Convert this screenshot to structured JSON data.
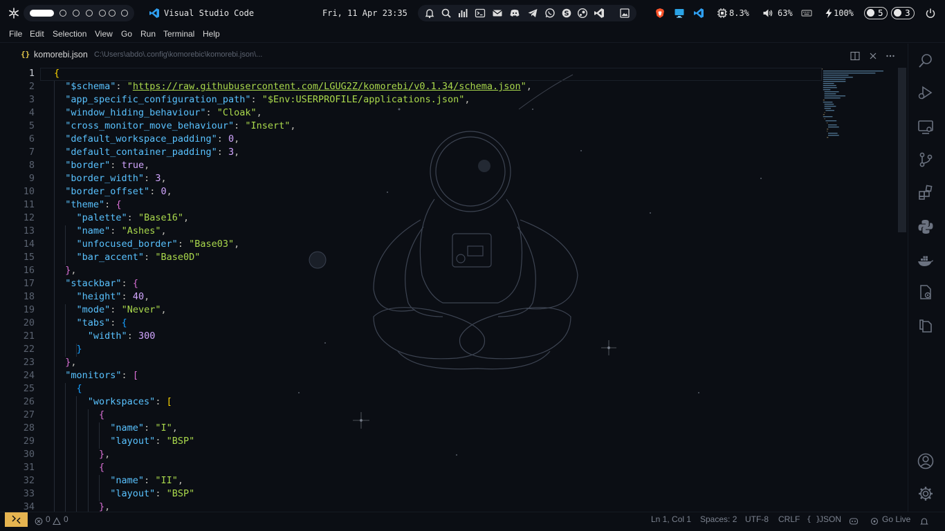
{
  "topbar": {
    "logo_icon": "snowflake-icon",
    "window_title": "Visual Studio Code",
    "datetime": "Fri, 11 Apr 23:35",
    "cpu": "8.3%",
    "volume": "63%",
    "battery": "100%",
    "badge_left": "5",
    "badge_right": "3"
  },
  "menu": [
    "File",
    "Edit",
    "Selection",
    "View",
    "Go",
    "Run",
    "Terminal",
    "Help"
  ],
  "tab": {
    "icon": "{}",
    "filename": "komorebi.json",
    "path": "C:\\Users\\abdo\\.config\\komorebic\\komorebi.json\\..."
  },
  "editor": {
    "line_numbers": [
      "1",
      "2",
      "3",
      "4",
      "5",
      "6",
      "7",
      "8",
      "9",
      "10",
      "11",
      "12",
      "13",
      "14",
      "15",
      "16",
      "17",
      "18",
      "19",
      "20",
      "21",
      "22",
      "23",
      "24",
      "25",
      "26",
      "27",
      "28",
      "29",
      "30",
      "31",
      "32",
      "33",
      "34"
    ],
    "lines": [
      "{",
      "  \"$schema\": \"https://raw.githubusercontent.com/LGUG2Z/komorebi/v0.1.34/schema.json\",",
      "  \"app_specific_configuration_path\": \"$Env:USERPROFILE/applications.json\",",
      "  \"window_hiding_behaviour\": \"Cloak\",",
      "  \"cross_monitor_move_behaviour\": \"Insert\",",
      "  \"default_workspace_padding\": 0,",
      "  \"default_container_padding\": 3,",
      "  \"border\": true,",
      "  \"border_width\": 3,",
      "  \"border_offset\": 0,",
      "  \"theme\": {",
      "    \"palette\": \"Base16\",",
      "    \"name\": \"Ashes\",",
      "    \"unfocused_border\": \"Base03\",",
      "    \"bar_accent\": \"Base0D\"",
      "  },",
      "  \"stackbar\": {",
      "    \"height\": 40,",
      "    \"mode\": \"Never\",",
      "    \"tabs\": {",
      "      \"width\": 300",
      "    }",
      "  },",
      "  \"monitors\": [",
      "    {",
      "      \"workspaces\": [",
      "        {",
      "          \"name\": \"I\",",
      "          \"layout\": \"BSP\"",
      "        },",
      "        {",
      "          \"name\": \"II\",",
      "          \"layout\": \"BSP\"",
      "        },"
    ]
  },
  "statusbar": {
    "errors": "0",
    "warnings": "0",
    "position": "Ln 1, Col 1",
    "spaces": "Spaces: 2",
    "encoding": "UTF-8",
    "eol": "CRLF",
    "language": "JSON",
    "golive": "Go Live"
  },
  "colors": {
    "background": "#0b0e14",
    "key": "#59c2ff",
    "string": "#aad94c",
    "number": "#d2a6ff",
    "remote_button": "#e6b450"
  }
}
